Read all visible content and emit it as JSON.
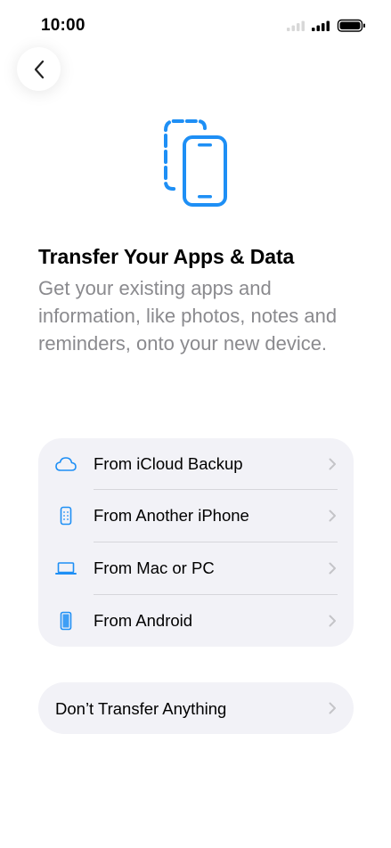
{
  "status_bar": {
    "time": "10:00",
    "icons": [
      "cellular-signal-icon",
      "cellular-signal-icon",
      "battery-icon"
    ]
  },
  "nav": {
    "back_icon": "chevron-left-icon"
  },
  "hero": {
    "icon": "iphone-transfer-icon",
    "title": "Transfer Your Apps & Data",
    "subtitle": "Get your existing apps and information, like photos, notes and reminders, onto your new device."
  },
  "options": [
    {
      "label": "From iCloud Backup",
      "icon": "cloud-icon"
    },
    {
      "label": "From Another iPhone",
      "icon": "iphone-icon"
    },
    {
      "label": "From Mac or PC",
      "icon": "laptop-icon"
    },
    {
      "label": "From Android",
      "icon": "android-phone-icon"
    }
  ],
  "dont_transfer": {
    "label": "Don’t Transfer Anything"
  },
  "colors": {
    "accent": "#1e8ff5",
    "card_background": "#f2f2f7",
    "secondary_text": "#8a8a8e",
    "chevron": "#c4c4c8"
  }
}
